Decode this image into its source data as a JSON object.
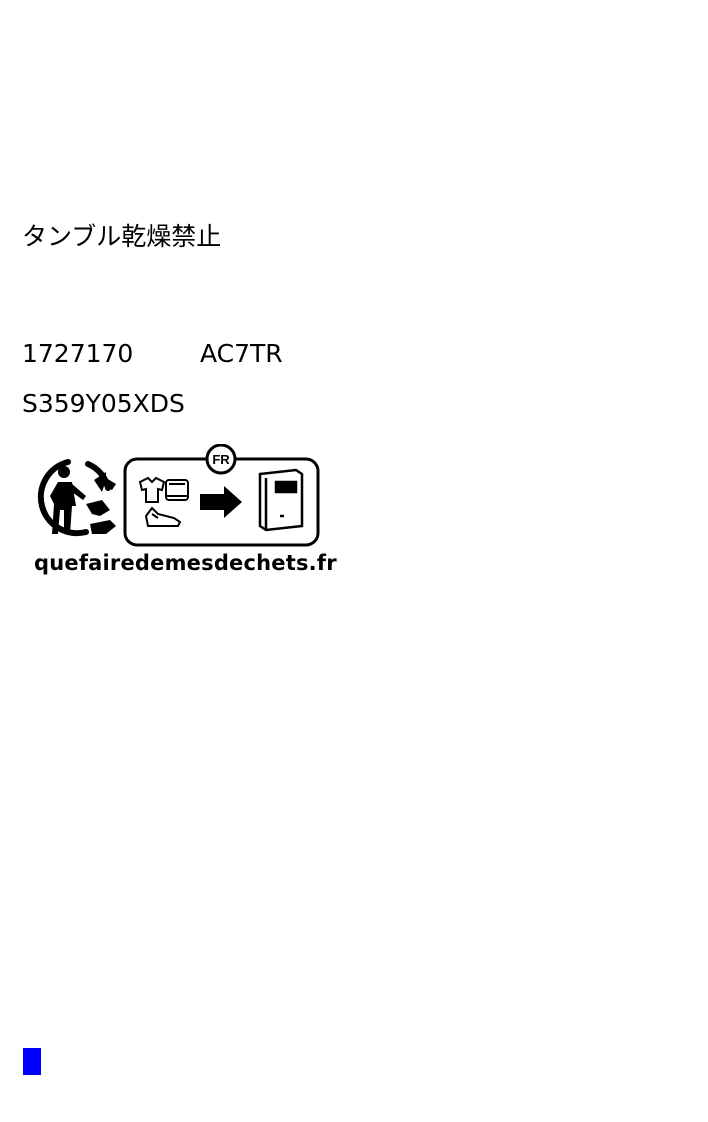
{
  "label": {
    "care_instruction": "タンブル乾燥禁止",
    "code_a": "1727170",
    "code_b": "AC7TR",
    "style_code": "S359Y05XDS"
  },
  "recycling": {
    "country_badge": "FR",
    "website": "quefairedemesdechets.fr",
    "icons": [
      "triman-icon",
      "tshirt-icon",
      "towel-icon",
      "shoe-icon",
      "arrow-right-icon",
      "collection-bin-icon"
    ]
  },
  "marker": {
    "color": "#0000ff"
  }
}
